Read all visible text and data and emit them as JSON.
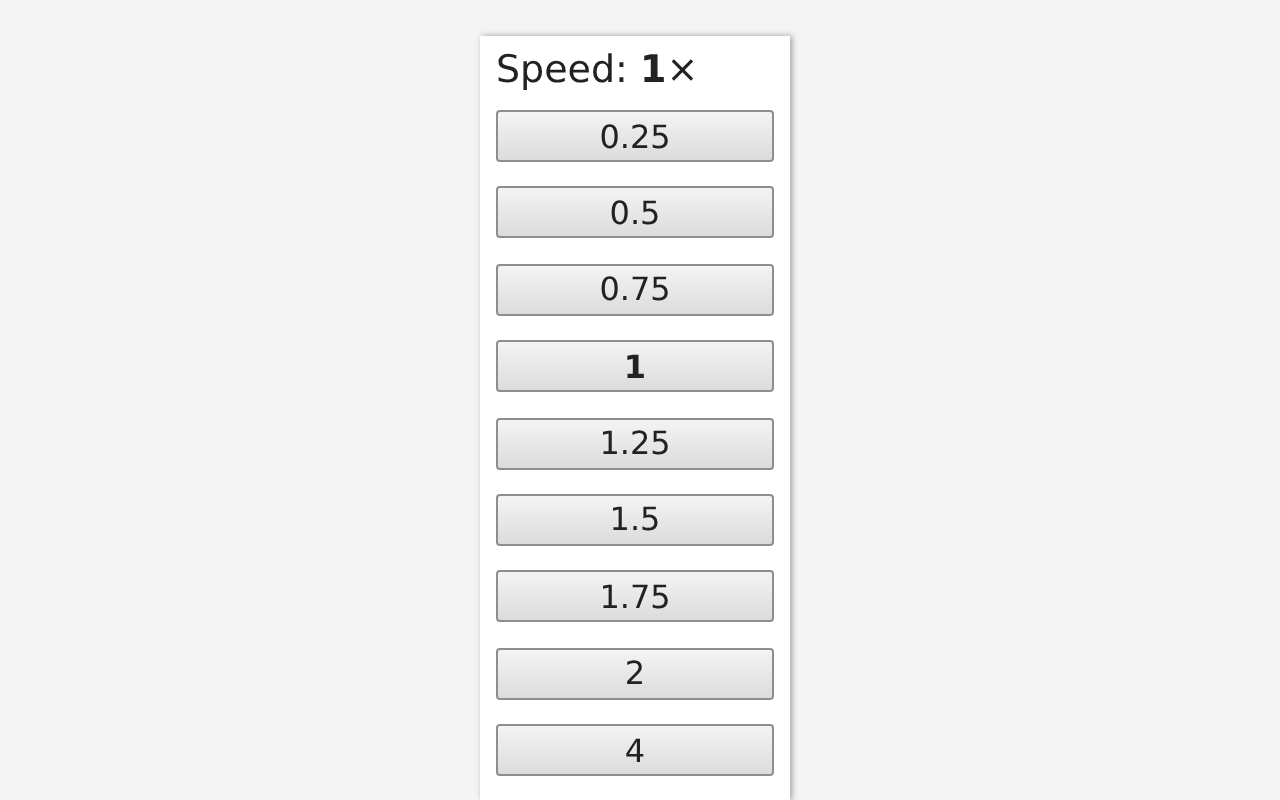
{
  "heading": "Speed: **1**×",
  "speeds": [
    {
      "label": "0.25",
      "selected": false
    },
    {
      "label": "0.5",
      "selected": false
    },
    {
      "label": "0.75",
      "selected": false
    },
    {
      "label": "1",
      "selected": true
    },
    {
      "label": "1.25",
      "selected": false
    },
    {
      "label": "1.5",
      "selected": false
    },
    {
      "label": "1.75",
      "selected": false
    },
    {
      "label": "2",
      "selected": false
    },
    {
      "label": "4",
      "selected": false
    }
  ]
}
